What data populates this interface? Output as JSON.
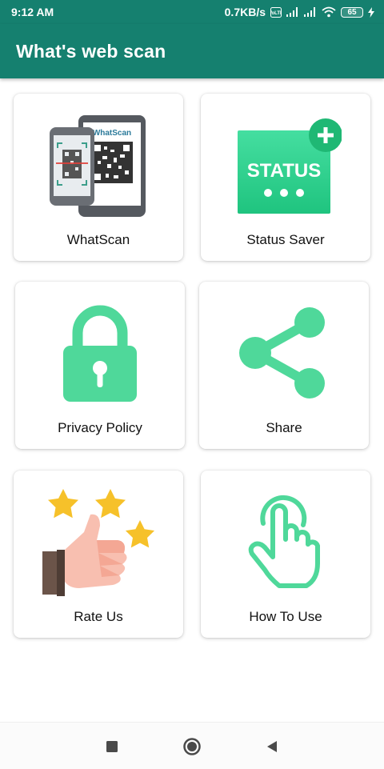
{
  "status_bar": {
    "time": "9:12 AM",
    "speed": "0.7KB/s",
    "battery": "65",
    "icons": [
      "volte-icon",
      "signal-icon",
      "signal-icon",
      "wifi-icon",
      "battery-icon",
      "charging-icon"
    ]
  },
  "app_bar": {
    "title": "What's web scan"
  },
  "menu": {
    "items": [
      {
        "label": "WhatScan",
        "icon": "qr-scan-phone-icon",
        "icon_text": "WhatScan"
      },
      {
        "label": "Status Saver",
        "icon": "status-icon",
        "icon_text": "STATUS"
      },
      {
        "label": "Privacy Policy",
        "icon": "lock-icon"
      },
      {
        "label": "Share",
        "icon": "share-icon"
      },
      {
        "label": "Rate Us",
        "icon": "thumbs-up-stars-icon"
      },
      {
        "label": "How To Use",
        "icon": "tap-hand-icon"
      }
    ]
  },
  "colors": {
    "primary": "#15806f",
    "accent_green": "#4fd89a",
    "status_green": "#31d38f",
    "star_yellow": "#f6c12a"
  },
  "nav_bar": {
    "buttons": [
      "recents-icon",
      "home-icon",
      "back-icon"
    ]
  }
}
